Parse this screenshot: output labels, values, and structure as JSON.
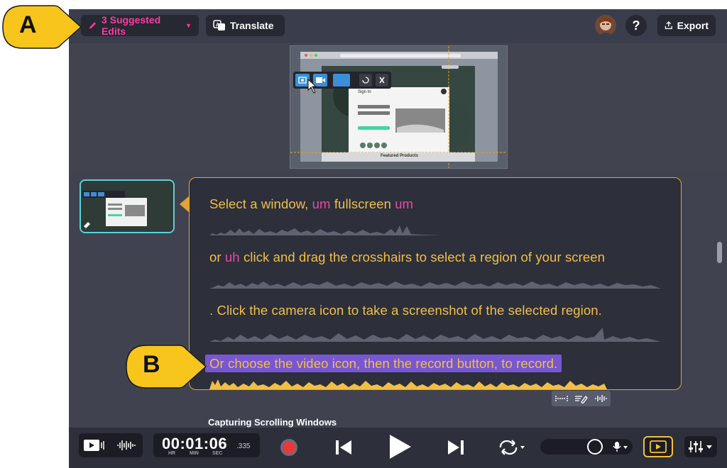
{
  "topbar": {
    "suggested_edits_label": "3 Suggested Edits",
    "translate_label": "Translate",
    "help_label": "?",
    "export_label": "Export"
  },
  "preview": {
    "signin_title": "Sign In",
    "featured_label": "Featured Products"
  },
  "transcript": {
    "line1": {
      "parts": [
        "Select a window,",
        "um",
        "fullscreen",
        "um"
      ]
    },
    "line2": {
      "parts": [
        "or",
        "uh",
        "click and drag the crosshairs to select a region of your screen"
      ]
    },
    "line3": ". Click the camera icon to take a screenshot of the selected region.",
    "line4": "Or choose the video icon, then the record button, to record."
  },
  "next_section_title": "Capturing Scrolling Windows",
  "player": {
    "timecode": "00:01:06",
    "timecode_ms": ".335",
    "units": [
      "HR",
      "MIN",
      "SEC"
    ]
  },
  "callouts": {
    "a": "A",
    "b": "B"
  },
  "colors": {
    "accent_gold": "#f2bf45",
    "filler_pink": "#e84aa6",
    "selection_purple": "#7757d2",
    "callout_yellow": "#f7c51c"
  },
  "icons": {
    "pencil": "pencil-icon",
    "translate": "translate-icon",
    "export": "export-icon",
    "camera": "camera-icon",
    "video": "video-icon",
    "record": "record-icon",
    "play": "play-icon"
  }
}
